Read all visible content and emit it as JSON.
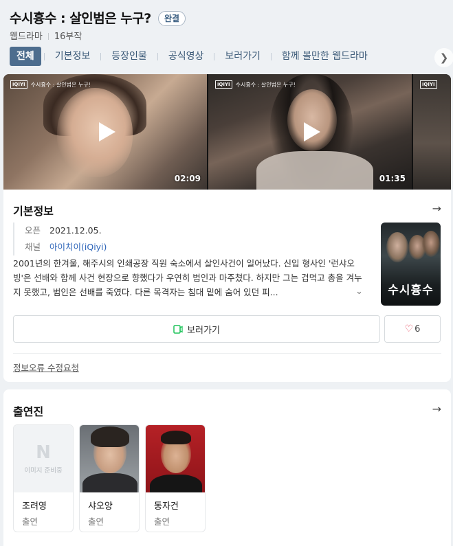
{
  "header": {
    "title": "수시흉수 : 살인범은 누구?",
    "badge": "완결",
    "genre": "웹드라마",
    "episodes": "16부작"
  },
  "tabs": [
    "전체",
    "기본정보",
    "등장인물",
    "공식영상",
    "보러가기",
    "함께 볼만한 웹드라마"
  ],
  "videos": [
    {
      "watermark_logo": "iQIYI",
      "watermark_text": "수시흉수 : 살인범은 누구!",
      "duration": "02:09"
    },
    {
      "watermark_logo": "iQIYI",
      "watermark_text": "수시흉수 : 살인범은 누구!",
      "duration": "01:35"
    },
    {
      "watermark_logo": "iQIYI",
      "watermark_text": "",
      "duration": ""
    }
  ],
  "basic_info": {
    "section_title": "기본정보",
    "open_label": "오픈",
    "open_value": "2021.12.05.",
    "channel_label": "채널",
    "channel_value": "아이치이(iQiyi)",
    "poster_title": "수시흉수",
    "synopsis": "2001년의 한겨울, 해주시의 인쇄공장 직원 숙소에서 살인사건이 일어났다. 신입 형사인 '런샤오빙'은 선배와 함께 사건 현장으로 향했다가 우연히 범인과 마주쳤다. 하지만 그는 겁먹고 총을 겨누지 못했고, 범인은 선배를 죽였다. 다른 목격자는 침대 밑에 숨어 있던 피...",
    "watch_label": "보러가기",
    "like_count": "6",
    "error_report": "정보오류 수정요청"
  },
  "cast": {
    "section_title": "출연진",
    "placeholder_text": "이미지 준비중",
    "members": [
      {
        "name": "조려영",
        "role": "출연"
      },
      {
        "name": "샤오양",
        "role": "출연"
      },
      {
        "name": "동자건",
        "role": "출연"
      }
    ]
  },
  "colors": {
    "accent": "#4d6d8e",
    "link": "#2b63b8",
    "watch_icon": "#1ec45a",
    "heart": "#e8455a"
  }
}
